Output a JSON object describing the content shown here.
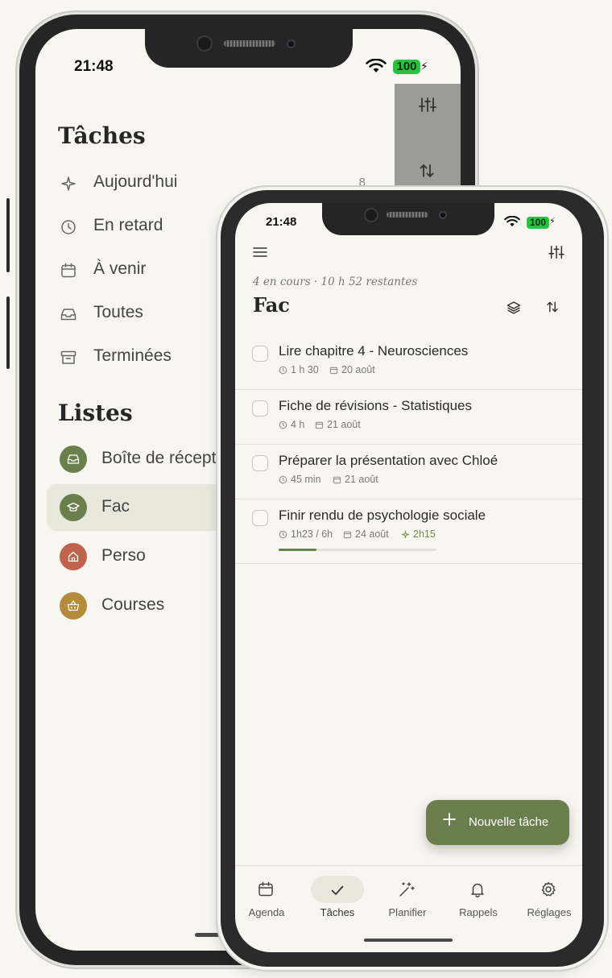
{
  "status": {
    "time": "21:48",
    "battery": "100"
  },
  "drawer": {
    "title": "Tâches",
    "menu": [
      {
        "label": "Aujourd'hui",
        "icon": "sparkle-icon",
        "count": "8"
      },
      {
        "label": "En retard",
        "icon": "clock-icon",
        "count": ""
      },
      {
        "label": "À venir",
        "icon": "calendar-icon",
        "count": ""
      },
      {
        "label": "Toutes",
        "icon": "inbox-icon",
        "count": ""
      },
      {
        "label": "Terminées",
        "icon": "archive-icon",
        "count": ""
      }
    ],
    "lists_title": "Listes",
    "lists": [
      {
        "label": "Boîte de réception",
        "icon": "inbox-icon",
        "color": "#6b7f4d"
      },
      {
        "label": "Fac",
        "icon": "graduation-cap-icon",
        "color": "#6b7f4d"
      },
      {
        "label": "Perso",
        "icon": "home-icon",
        "color": "#c0634c"
      },
      {
        "label": "Courses",
        "icon": "basket-icon",
        "color": "#b58a3a"
      }
    ]
  },
  "main": {
    "subtitle": "4 en cours · 10 h 52 restantes",
    "title": "Fac",
    "tasks": [
      {
        "title": "Lire chapitre 4 - Neurosciences",
        "duration": "1 h 30",
        "date": "20 août"
      },
      {
        "title": "Fiche de révisions - Statistiques",
        "duration": "4 h",
        "date": "21 août"
      },
      {
        "title": "Préparer la présentation avec Chloé",
        "duration": "45 min",
        "date": "21 août"
      },
      {
        "title": "Finir rendu de psychologie sociale",
        "duration": "1h23 / 6h",
        "date": "24 août",
        "planned": "2h15",
        "progress": 0.24
      }
    ],
    "fab_label": "Nouvelle tâche"
  },
  "tabs": [
    {
      "label": "Agenda",
      "icon": "calendar-icon"
    },
    {
      "label": "Tâches",
      "icon": "check-icon",
      "active": true
    },
    {
      "label": "Planifier",
      "icon": "magic-wand-icon"
    },
    {
      "label": "Rappels",
      "icon": "bell-icon"
    },
    {
      "label": "Réglages",
      "icon": "gear-icon"
    }
  ],
  "colors": {
    "accent": "#6b7f4d",
    "background": "#f8f6f1",
    "active_bg": "#e8e9dc"
  }
}
